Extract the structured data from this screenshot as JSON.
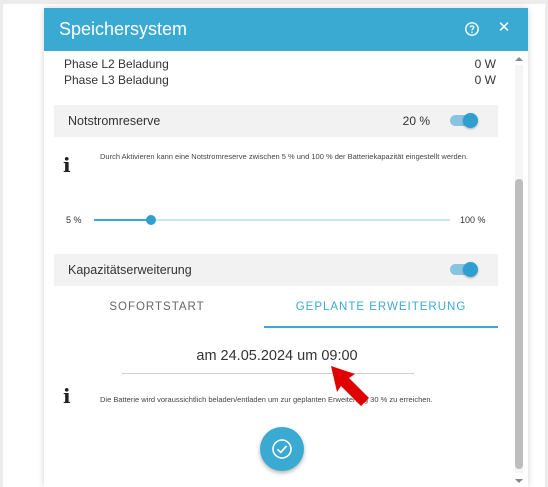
{
  "dialog": {
    "title": "Speichersystem",
    "help_icon": "help-circle-icon",
    "close_icon": "close-icon"
  },
  "rows": [
    {
      "label": "Phase L2 Beladung",
      "value": "0 W"
    },
    {
      "label": "Phase L3 Beladung",
      "value": "0 W"
    }
  ],
  "notstrom": {
    "label": "Notstromreserve",
    "value": "20 %",
    "toggle_on": true,
    "info_text": "Durch Aktivieren kann eine Notstromreserve zwischen 5 % und 100 % der Batteriekapazität eingestellt werden.",
    "slider_min_label": "5 %",
    "slider_max_label": "100 %",
    "slider_level": 0.16
  },
  "kapazitaet": {
    "label": "Kapazitätserweiterung",
    "toggle_on": true
  },
  "tabs": [
    {
      "label": "SOFORTSTART",
      "active": false
    },
    {
      "label": "GEPLANTE ERWEITERUNG",
      "active": true
    }
  ],
  "schedule": {
    "date_text": "am 24.05.2024 um 09:00",
    "info_text": "Die Batterie wird voraussichtlich beladen/entladen um zur geplanten Erweiterung 30 % zu erreichen."
  },
  "confirm_icon": "check-circle-icon",
  "colors": {
    "accent": "#3aaad3",
    "annotation_arrow": "#e00000"
  }
}
